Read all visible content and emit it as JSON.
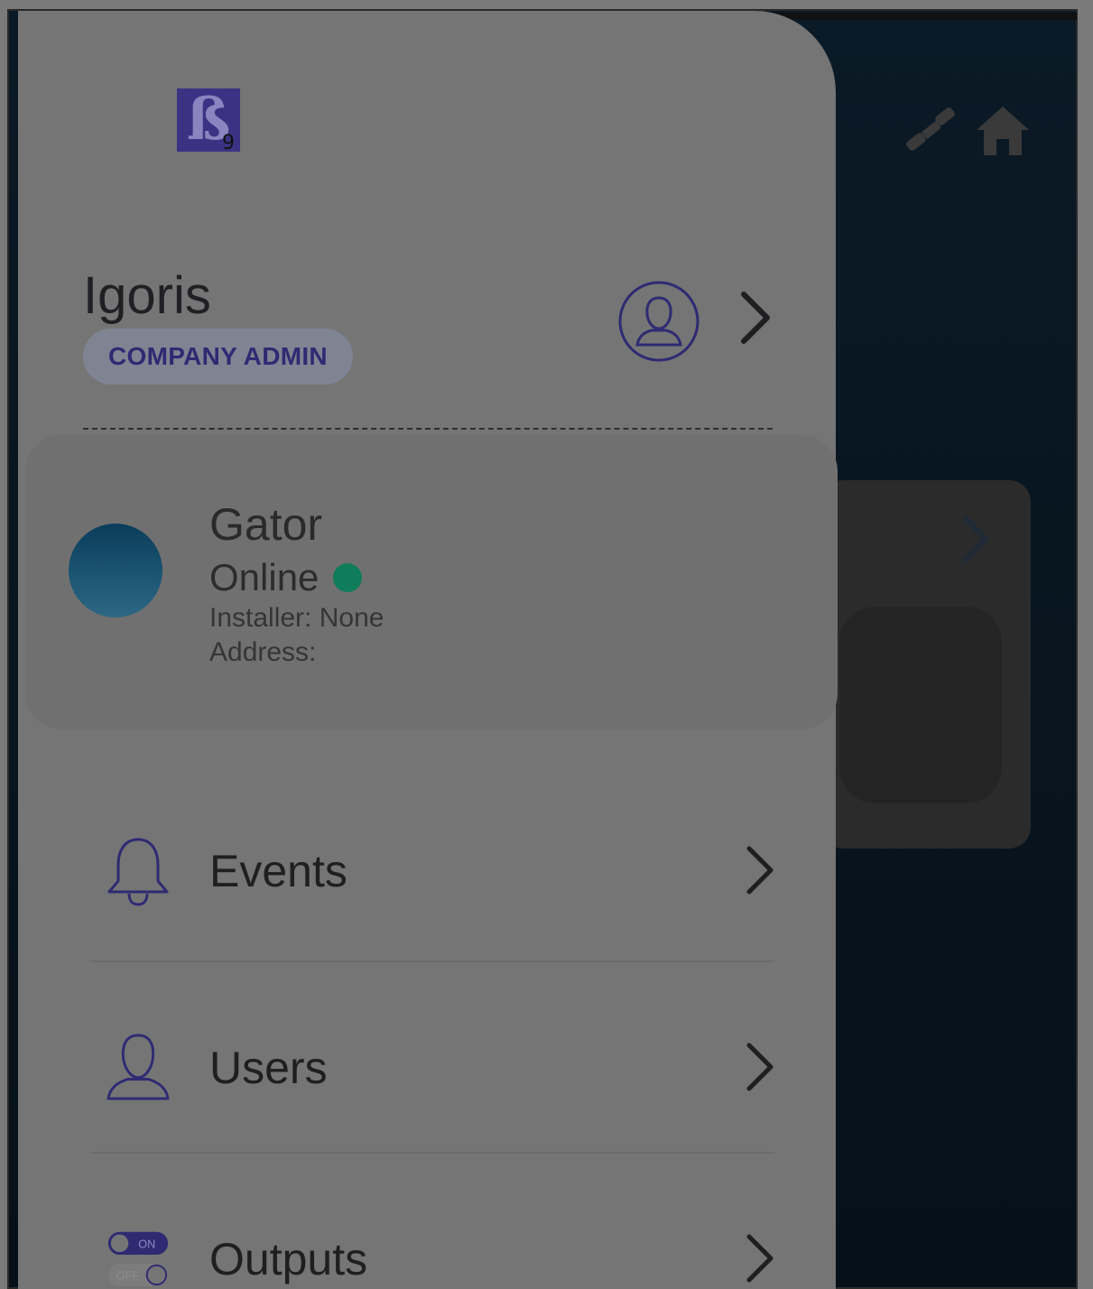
{
  "app": {
    "logo": {
      "letter": "ß",
      "subscript": "9"
    }
  },
  "background": {
    "icons": [
      "satellite-icon",
      "home-icon"
    ]
  },
  "profile": {
    "name": "Igoris",
    "role": "COMPANY ADMIN"
  },
  "site": {
    "name": "Gator",
    "status": "Online",
    "status_color": "#0f7c5a",
    "installer": "Installer: None",
    "address": "Address:"
  },
  "menu": {
    "items": [
      {
        "label": "Events",
        "icon": "bell-icon"
      },
      {
        "label": "Users",
        "icon": "user-icon"
      },
      {
        "label": "Outputs",
        "icon": "toggle-icon"
      }
    ],
    "toggle_on": "ON",
    "toggle_off": "OFF"
  },
  "colors": {
    "accent": "#3c3284",
    "drawer": "#757575",
    "overlay_bg": "#0b1820"
  }
}
